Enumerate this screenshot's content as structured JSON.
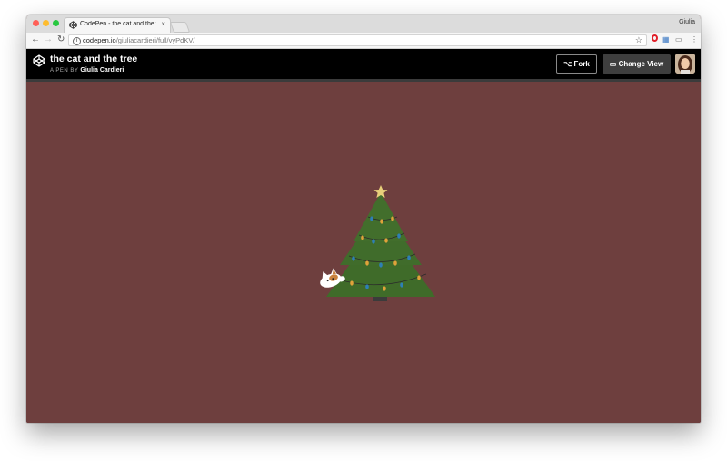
{
  "browser": {
    "tab_title": "CodePen - the cat and the tree",
    "tab_close": "×",
    "profile_name": "Giulia",
    "url_host": "codepen.io",
    "url_path": "/giuliacardieri/full/vyPdKV/"
  },
  "codepen": {
    "pen_title": "the cat and the tree",
    "pen_by_label": "A PEN BY",
    "author": "Giulia Cardieri",
    "fork_label": "Fork",
    "change_view_label": "Change View"
  },
  "colors": {
    "page_background": "#6e3f3e",
    "tree_green": "#3e6b2a",
    "star": "#e8cf7a",
    "header": "#000000"
  },
  "icons": {
    "tab": "codepen-favicon",
    "nav": [
      "back-arrow-icon",
      "forward-arrow-icon",
      "reload-icon"
    ],
    "omnibox": [
      "info-icon",
      "star-icon"
    ],
    "extensions": [
      "opera-icon",
      "extension-icon",
      "cast-icon",
      "menu-icon"
    ],
    "header": [
      "codepen-logo-icon",
      "fork-icon",
      "change-view-icon"
    ]
  }
}
